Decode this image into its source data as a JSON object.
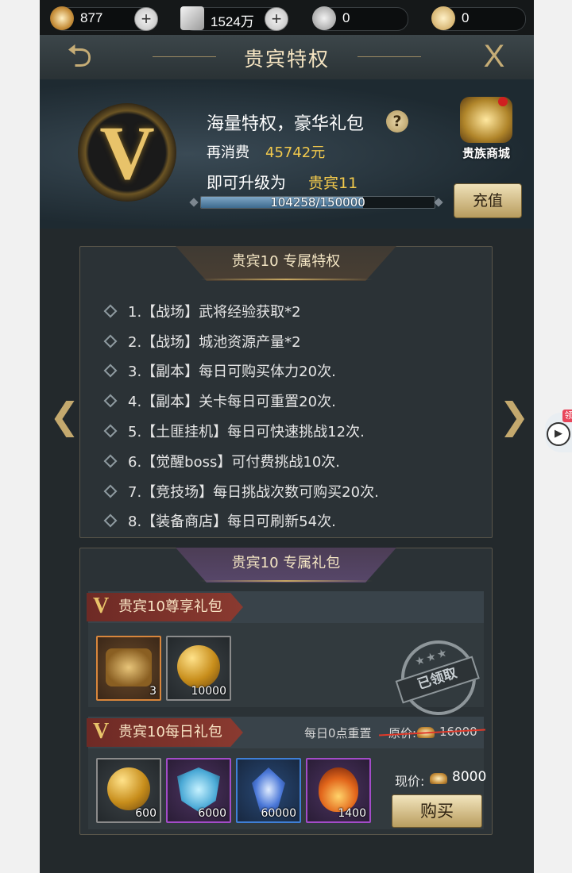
{
  "topbar": {
    "copper": {
      "value": "877",
      "icon": "copper-ingot-icon"
    },
    "silver": {
      "value": "1524万",
      "icon": "silver-ingot-icon"
    },
    "coin": {
      "value": "0",
      "icon": "coin-icon"
    },
    "food": {
      "value": "0",
      "icon": "wheat-icon"
    },
    "plus": "+"
  },
  "header": {
    "title": "贵宾特权",
    "back": "⮌",
    "close": "X"
  },
  "vip": {
    "badge": "V",
    "headline": "海量特权，豪华礼包",
    "help": "?",
    "spend_label": "再消费",
    "spend_value": "45742元",
    "upgrade_label": "即可升级为",
    "upgrade_level": "贵宾11",
    "progress_text": "104258/150000",
    "progress_fraction": 0.695,
    "shop_label": "贵族商城",
    "recharge_label": "充值"
  },
  "privileges": {
    "tab_title": "贵宾10 专属特权",
    "items": [
      "1.【战场】武将经验获取*2",
      "2.【战场】城池资源产量*2",
      "3.【副本】每日可购买体力20次.",
      "4.【副本】关卡每日可重置20次.",
      "5.【土匪挂机】每日可快速挑战12次.",
      "6.【觉醒boss】可付费挑战10次.",
      "7.【竞技场】每日挑战次数可购买20次.",
      "8.【装备商店】每日可刷新54次."
    ]
  },
  "nav": {
    "prev": "❮",
    "next": "❯"
  },
  "gifts": {
    "tab_title": "贵宾10 专属礼包",
    "exclusive": {
      "title": "贵宾10尊享礼包",
      "items": [
        {
          "count": "3",
          "icon": "treasure-chest-icon"
        },
        {
          "count": "10000",
          "icon": "gold-orb-icon"
        }
      ],
      "stamp": "已领取",
      "stamp_stars": "★★★"
    },
    "daily": {
      "title": "贵宾10每日礼包",
      "reset_note": "每日0点重置",
      "original_label": "原价:",
      "original_price": "16000",
      "current_label": "现价:",
      "current_price": "8000",
      "buy_label": "购买",
      "items": [
        {
          "count": "600",
          "icon": "gold-orb-icon"
        },
        {
          "count": "6000",
          "icon": "ice-shield-icon"
        },
        {
          "count": "60000",
          "icon": "blue-crystal-icon"
        },
        {
          "count": "1400",
          "icon": "fire-orb-icon"
        }
      ]
    }
  },
  "float_widget": {
    "tag": "领",
    "play": "▶"
  }
}
